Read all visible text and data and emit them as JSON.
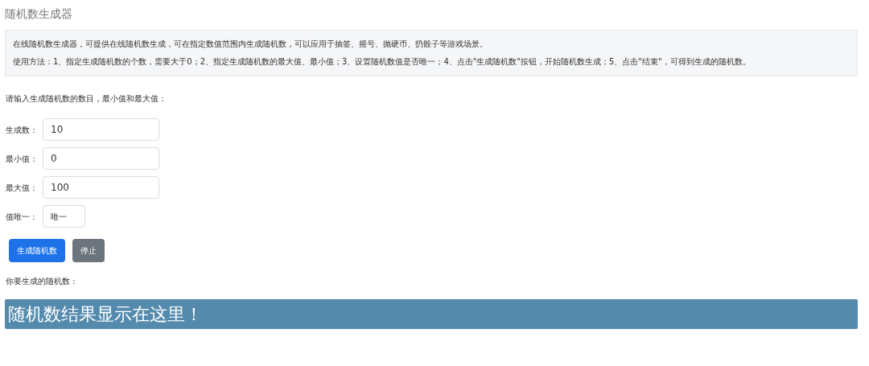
{
  "title": "随机数生成器",
  "intro": [
    "在线随机数生成器，可提供在线随机数生成，可在指定数值范围内生成随机数，可以应用于抽签、摇号、抛硬币、扔骰子等游戏场景。",
    "使用方法：1、指定生成随机数的个数，需要大于0；2、指定生成随机数的最大值、最小值；3、设置随机数值是否唯一；4、点击\"生成随机数\"按钮，开始随机数生成；5、点击\"结束\"，可得到生成的随机数。"
  ],
  "prompt": "请输入生成随机数的数目，最小值和最大值：",
  "fields": [
    {
      "label": "生成数：",
      "value": "10",
      "kind": "text"
    },
    {
      "label": "最小值：",
      "value": "0",
      "kind": "text"
    },
    {
      "label": "最大值：",
      "value": "100",
      "kind": "text"
    },
    {
      "label": "值唯一：",
      "value": "唯一",
      "kind": "select"
    }
  ],
  "buttons": [
    {
      "label": "生成随机数",
      "kind": "primary"
    },
    {
      "label": "停止",
      "kind": "secondary"
    }
  ],
  "result_label": "你要生成的随机数：",
  "result": "随机数结果显示在这里！"
}
